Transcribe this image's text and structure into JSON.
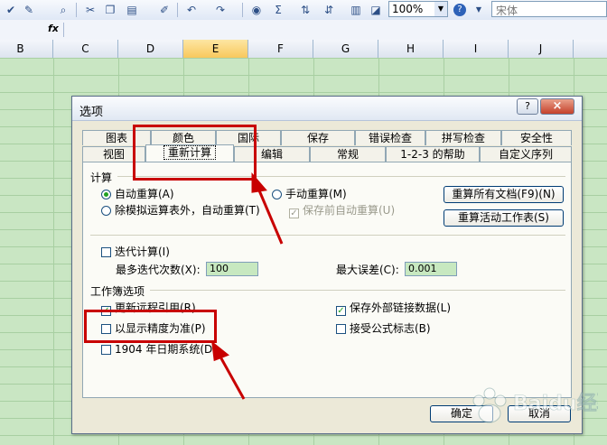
{
  "toolbar": {
    "zoom": "100%",
    "font": "宋体"
  },
  "formula_bar": {
    "fx": "fx"
  },
  "columns": [
    "B",
    "C",
    "D",
    "E",
    "F",
    "G",
    "H",
    "I",
    "J"
  ],
  "dialog": {
    "title": "选项",
    "help": "?",
    "close": "×",
    "tabs_row1": [
      "图表",
      "颜色",
      "国际",
      "保存",
      "错误检查",
      "拼写检查",
      "安全性"
    ],
    "tabs_row2": [
      "视图",
      "重新计算",
      "编辑",
      "常规",
      "1-2-3 的帮助",
      "自定义序列"
    ],
    "active_tab": "重新计算",
    "calc": {
      "group": "计算",
      "auto": "自动重算(A)",
      "auto_except": "除模拟运算表外，自动重算(T)",
      "manual": "手动重算(M)",
      "save_before": "保存前自动重算(U)",
      "recalc_all": "重算所有文档(F9)(N)",
      "recalc_sheet": "重算活动工作表(S)"
    },
    "iteration": {
      "label": "迭代计算(I)",
      "max_iter_label": "最多迭代次数(X):",
      "max_iter_value": "100",
      "max_change_label": "最大误差(C):",
      "max_change_value": "0.001"
    },
    "workbook": {
      "group": "工作簿选项",
      "update_refs": "更新远程引用(R)",
      "precision": "以显示精度为准(P)",
      "date1904": "1904 年日期系统(D)",
      "save_links": "保存外部链接数据(L)",
      "accept_labels": "接受公式标志(B)"
    },
    "ok": "确定",
    "cancel": "取消"
  },
  "watermark": "Baidu经验",
  "colors": {
    "annotation": "#c80000",
    "grid_bg": "#c9e6c3"
  }
}
